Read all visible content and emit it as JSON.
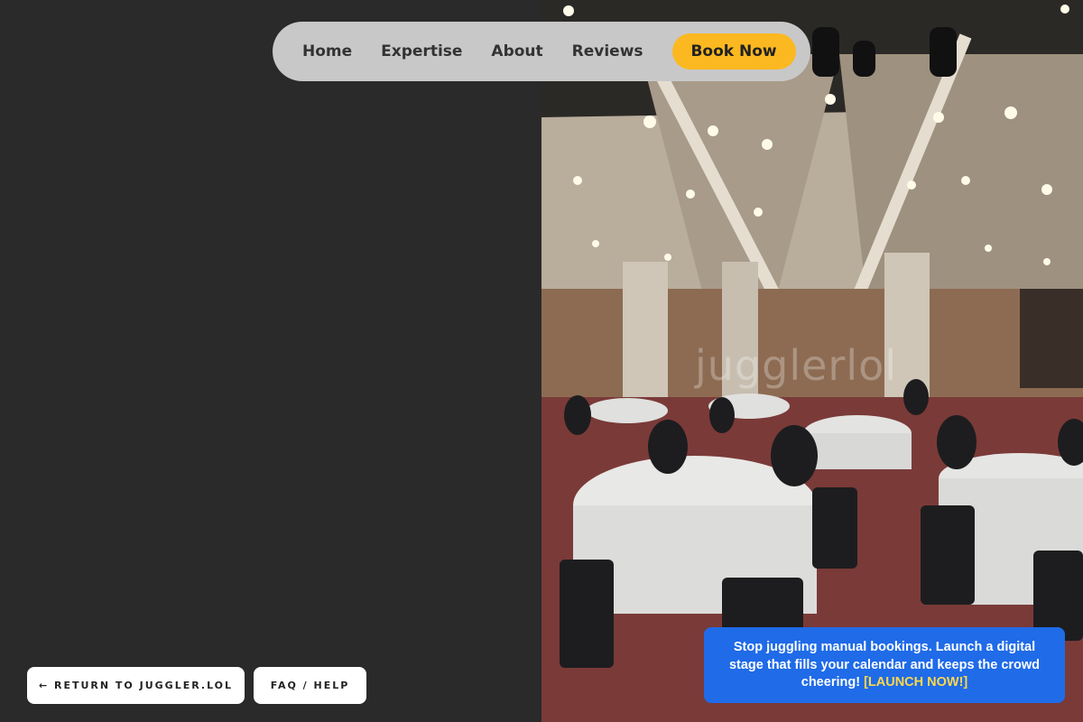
{
  "nav": {
    "links": [
      "Home",
      "Expertise",
      "About",
      "Reviews"
    ],
    "cta": "Book Now"
  },
  "hero": {
    "watermark": "jugglerlol"
  },
  "footer_buttons": {
    "return": "← RETURN TO JUGGLER.LOL",
    "faq": "FAQ / HELP"
  },
  "promo": {
    "text": "Stop juggling manual bookings. Launch a digital stage that fills your calendar and keeps the crowd cheering!",
    "cta": "[LAUNCH NOW!]"
  },
  "colors": {
    "background": "#2a2a2a",
    "nav_bg": "#c8c8c8",
    "cta_yellow": "#fbb820",
    "promo_blue": "#1f6be8"
  }
}
